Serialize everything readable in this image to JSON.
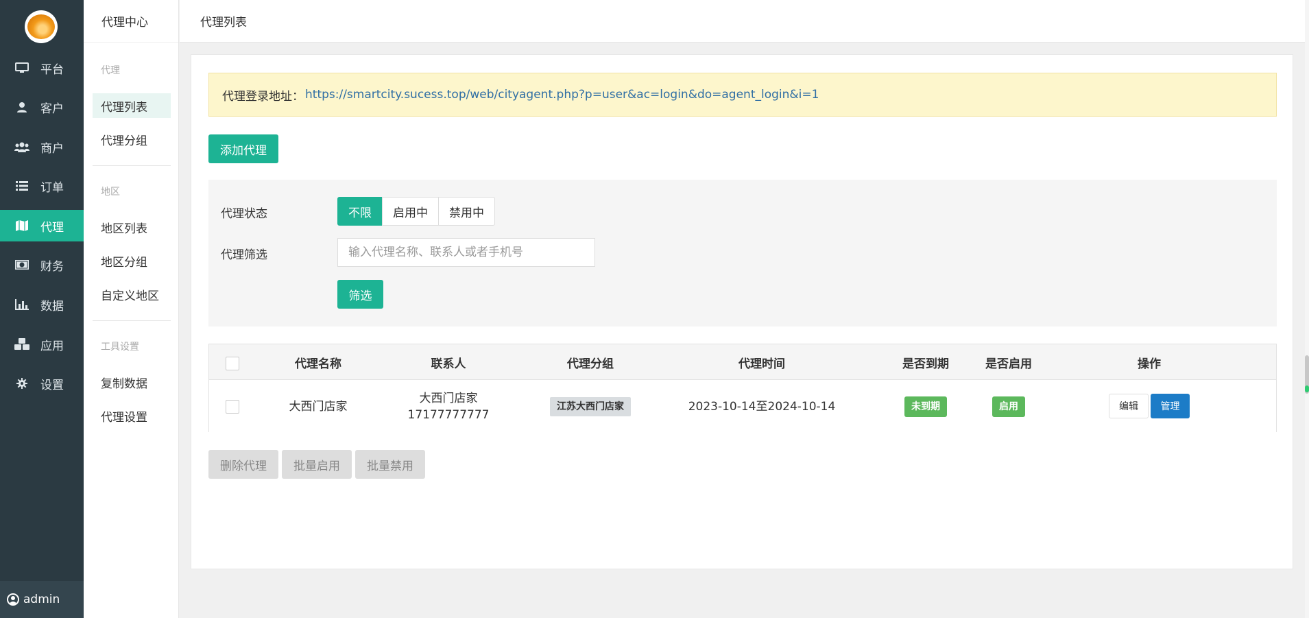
{
  "user": {
    "name": "admin",
    "icon": "user-circle-icon"
  },
  "sidebar": {
    "items": [
      {
        "label": "平台",
        "icon": "monitor-icon",
        "active": false
      },
      {
        "label": "客户",
        "icon": "user-icon",
        "active": false
      },
      {
        "label": "商户",
        "icon": "users-icon",
        "active": false
      },
      {
        "label": "订单",
        "icon": "list-icon",
        "active": false
      },
      {
        "label": "代理",
        "icon": "map-icon",
        "active": true
      },
      {
        "label": "财务",
        "icon": "money-icon",
        "active": false
      },
      {
        "label": "数据",
        "icon": "bar-chart-icon",
        "active": false
      },
      {
        "label": "应用",
        "icon": "cubes-icon",
        "active": false
      },
      {
        "label": "设置",
        "icon": "gear-icon",
        "active": false
      }
    ]
  },
  "subnav": {
    "title": "代理中心",
    "groups": [
      {
        "title": "代理",
        "links": [
          "代理列表",
          "代理分组"
        ]
      },
      {
        "title": "地区",
        "links": [
          "地区列表",
          "地区分组",
          "自定义地区"
        ]
      },
      {
        "title": "工具设置",
        "links": [
          "复制数据",
          "代理设置"
        ]
      }
    ],
    "active_link": "代理列表"
  },
  "header": {
    "breadcrumb": "代理列表"
  },
  "alert": {
    "label": "代理登录地址：",
    "url": "https://smartcity.sucess.top/web/cityagent.php?p=user&ac=login&do=agent_login&i=1"
  },
  "toolbar": {
    "add_label": "添加代理"
  },
  "filter": {
    "status_label": "代理状态",
    "status_options": [
      "不限",
      "启用中",
      "禁用中"
    ],
    "status_selected": "不限",
    "search_label": "代理筛选",
    "search_placeholder": "输入代理名称、联系人或者手机号",
    "search_value": "",
    "submit_label": "筛选"
  },
  "table": {
    "columns": [
      "代理名称",
      "联系人",
      "代理分组",
      "代理时间",
      "是否到期",
      "是否启用",
      "操作"
    ],
    "rows": [
      {
        "name": "大西门店家",
        "contact_name": "大西门店家",
        "contact_phone": "17177777777",
        "group": "江苏大西门店家",
        "time": "2023-10-14至2024-10-14",
        "expired": "未到期",
        "enabled": "启用",
        "edit_label": "编辑",
        "manage_label": "管理"
      }
    ]
  },
  "bulk_actions": {
    "delete": "删除代理",
    "enable": "批量启用",
    "disable": "批量禁用"
  },
  "colors": {
    "primary": "#1db394",
    "sidebar_bg": "#2b3a42",
    "blue": "#1c7cc7",
    "alert_bg": "#fdf6cc",
    "tag_green": "#5cb85c"
  }
}
